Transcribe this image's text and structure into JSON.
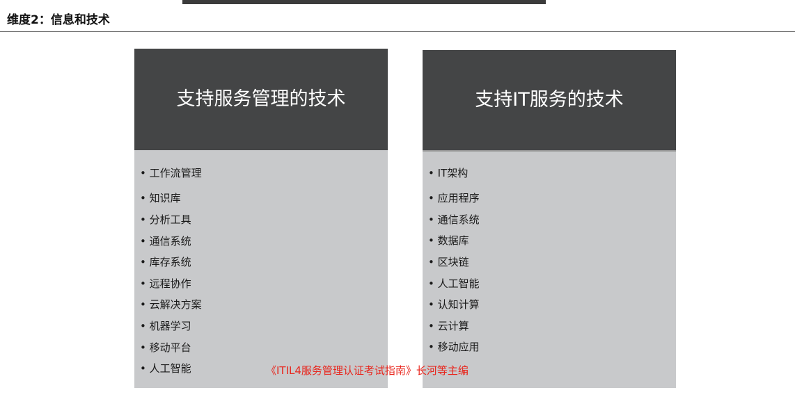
{
  "page": {
    "title": "维度2：信息和技术"
  },
  "cards": {
    "left": {
      "heading": "支持服务管理的技术",
      "items": [
        "• 工作流管理",
        "• 知识库",
        "• 分析工具",
        "• 通信系统",
        "• 库存系统",
        "• 远程协作",
        "• 云解决方案",
        "• 机器学习",
        "• 移动平台",
        "• 人工智能"
      ]
    },
    "right": {
      "heading": "支持IT服务的技术",
      "items": [
        "• IT架构",
        "• 应用程序",
        "• 通信系统",
        "• 数据库",
        "• 区块链",
        "• 人工智能",
        "• 认知计算",
        "• 云计算",
        "• 移动应用"
      ]
    }
  },
  "caption": "《ITIL4服务管理认证考试指南》长河等主编",
  "colors": {
    "header_bg": "#444546",
    "card_bg": "#c8c9cb",
    "caption": "#e8251c"
  }
}
